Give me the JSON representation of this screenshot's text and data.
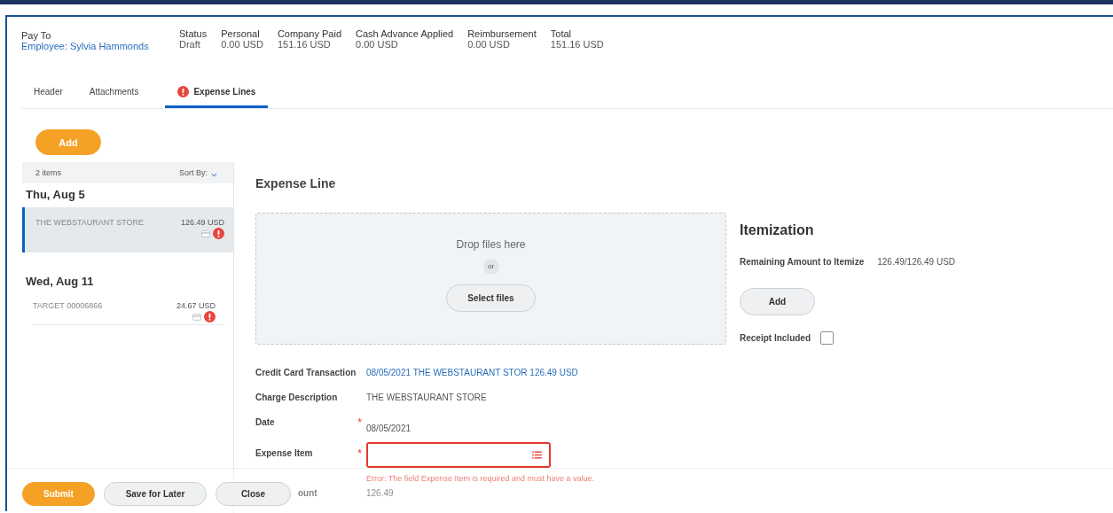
{
  "summary": {
    "pay_to": {
      "label": "Pay To",
      "value": "Employee: Sylvia Hammonds"
    },
    "fields": [
      {
        "label": "Status",
        "value": "Draft"
      },
      {
        "label": "Personal",
        "value": "0.00 USD"
      },
      {
        "label": "Company Paid",
        "value": "151.16 USD"
      },
      {
        "label": "Cash Advance Applied",
        "value": "0.00 USD"
      },
      {
        "label": "Reimbursement",
        "value": "0.00 USD"
      },
      {
        "label": "Total",
        "value": "151.16 USD"
      }
    ]
  },
  "tabs": [
    {
      "label": "Header",
      "selected": false,
      "error": false
    },
    {
      "label": "Attachments",
      "selected": false,
      "error": false
    },
    {
      "label": "Expense Lines",
      "selected": true,
      "error": true
    }
  ],
  "add_button": "Add",
  "list": {
    "count": "2 items",
    "sort_label": "Sort By:",
    "groups": [
      {
        "date": "Thu, Aug 5",
        "items": [
          {
            "merchant": "THE WEBSTAURANT STORE",
            "amount": "126.49 USD",
            "selected": true,
            "error": true
          }
        ]
      },
      {
        "date": "Wed, Aug 11",
        "items": [
          {
            "merchant": "TARGET 00006866",
            "amount": "24.67 USD",
            "selected": false,
            "error": true
          }
        ]
      }
    ]
  },
  "expense_line": {
    "title": "Expense Line",
    "required_mark": "*",
    "dropzone": {
      "text": "Drop files here",
      "or": "or",
      "button": "Select files"
    },
    "fields": [
      {
        "kind": "link",
        "label": "Credit Card Transaction",
        "value": "08/05/2021 THE WEBSTAURANT STOR 126.49 USD",
        "required": false
      },
      {
        "kind": "text",
        "label": "Charge Description",
        "value": "THE WEBSTAURANT STORE",
        "required": false
      },
      {
        "kind": "text",
        "label": "Date",
        "value": "08/05/2021",
        "required": true
      },
      {
        "kind": "select",
        "label": "Expense Item",
        "required": true,
        "error": "Error: The field Expense Item is required and must have a value."
      },
      {
        "kind": "text",
        "label": "ount",
        "value": "126.49",
        "required": false
      }
    ]
  },
  "itemization": {
    "title": "Itemization",
    "remaining_label": "Remaining Amount to Itemize",
    "remaining_value": "126.49/126.49 USD",
    "add_button": "Add",
    "receipt_label": "Receipt Included",
    "receipt_checked": false
  },
  "footer": {
    "buttons": [
      {
        "label": "Submit",
        "kind": "primary"
      },
      {
        "label": "Save for Later",
        "kind": "secondary"
      },
      {
        "label": "Close",
        "kind": "secondary"
      }
    ]
  }
}
